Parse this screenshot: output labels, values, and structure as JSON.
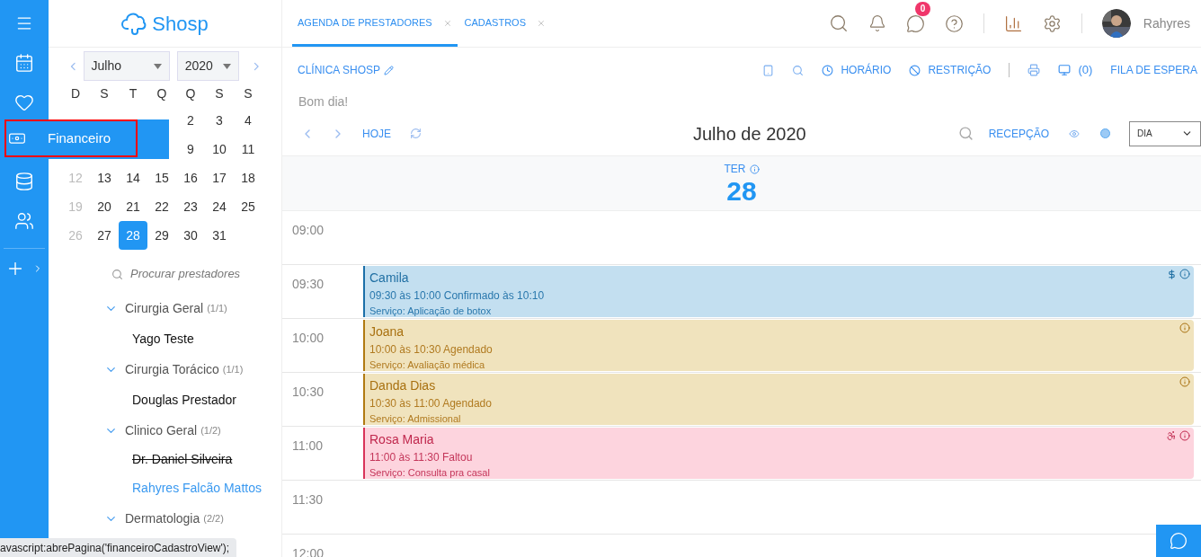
{
  "rail": {
    "tooltip": "Financeiro"
  },
  "logo": {
    "text": "Shosp"
  },
  "calendar": {
    "month": "Julho",
    "year": "2020",
    "weekdays": [
      "D",
      "S",
      "T",
      "Q",
      "Q",
      "S",
      "S"
    ],
    "weeks": [
      [
        {
          "day": "2",
          "muted": false,
          "selected": false
        },
        {
          "day": "3",
          "muted": false,
          "selected": false
        },
        {
          "day": "4",
          "muted": false,
          "selected": false
        }
      ],
      [
        {
          "day": "9",
          "muted": false,
          "selected": false
        },
        {
          "day": "10",
          "muted": false,
          "selected": false
        },
        {
          "day": "11",
          "muted": false,
          "selected": false
        }
      ],
      [
        {
          "day": "12",
          "muted": true,
          "selected": false
        },
        {
          "day": "13",
          "muted": false,
          "selected": false
        },
        {
          "day": "14",
          "muted": false,
          "selected": false
        },
        {
          "day": "15",
          "muted": false,
          "selected": false
        },
        {
          "day": "16",
          "muted": false,
          "selected": false
        },
        {
          "day": "17",
          "muted": false,
          "selected": false
        },
        {
          "day": "18",
          "muted": false,
          "selected": false
        }
      ],
      [
        {
          "day": "19",
          "muted": true,
          "selected": false
        },
        {
          "day": "20",
          "muted": false,
          "selected": false
        },
        {
          "day": "21",
          "muted": false,
          "selected": false
        },
        {
          "day": "22",
          "muted": false,
          "selected": false
        },
        {
          "day": "23",
          "muted": false,
          "selected": false
        },
        {
          "day": "24",
          "muted": false,
          "selected": false
        },
        {
          "day": "25",
          "muted": false,
          "selected": false
        }
      ],
      [
        {
          "day": "26",
          "muted": true,
          "selected": false
        },
        {
          "day": "27",
          "muted": false,
          "selected": false
        },
        {
          "day": "28",
          "muted": false,
          "selected": true
        },
        {
          "day": "29",
          "muted": false,
          "selected": false
        },
        {
          "day": "30",
          "muted": false,
          "selected": false
        },
        {
          "day": "31",
          "muted": false,
          "selected": false
        }
      ]
    ]
  },
  "search": {
    "placeholder": "Procurar prestadores"
  },
  "groups": [
    {
      "name": "Cirurgia Geral",
      "count": "(1/1)",
      "expanded": true,
      "children": [
        {
          "name": "Yago Teste",
          "inactive": false,
          "selected": false
        }
      ]
    },
    {
      "name": "Cirurgia Torácico",
      "count": "(1/1)",
      "expanded": true,
      "children": [
        {
          "name": "Douglas Prestador",
          "inactive": false,
          "selected": false
        }
      ]
    },
    {
      "name": "Clinico Geral",
      "count": "(1/2)",
      "expanded": true,
      "children": [
        {
          "name": "Dr. Daniel Silveira",
          "inactive": true,
          "selected": false
        },
        {
          "name": "Rahyres Falcão Mattos",
          "inactive": false,
          "selected": true
        }
      ]
    },
    {
      "name": "Dermatologia",
      "count": "(2/2)",
      "expanded": true
    }
  ],
  "status_bar": "avascript:abrePagina('financeiroCadastroView');",
  "tabs": [
    {
      "label": "AGENDA DE PRESTADORES",
      "selected": true
    },
    {
      "label": "CADASTROS",
      "selected": false
    }
  ],
  "header": {
    "chat_badge": "0",
    "user": "Rahyres"
  },
  "toolbar": {
    "clinic": "CLÍNICA SHOSP",
    "horario": "HORÁRIO",
    "restricao": "RESTRIÇÃO",
    "screen_count": "(0)",
    "queue": "FILA DE ESPERA"
  },
  "greeting": "Bom dia!",
  "nav": {
    "today": "HOJE",
    "title": "Julho de 2020",
    "reception": "RECEPÇÃO",
    "view": "DIA"
  },
  "day": {
    "weekday": "TER",
    "date": "28"
  },
  "slots": [
    {
      "time": "09:00"
    },
    {
      "time": "09:30",
      "event": {
        "kind": "confirmed",
        "name": "Camila",
        "time": "09:30 às 10:00 Confirmado às 10:10",
        "service": "Serviço: Aplicação de botox",
        "paid": true,
        "accessibility": false
      }
    },
    {
      "time": "10:00",
      "event": {
        "kind": "scheduled",
        "name": "Joana",
        "time": "10:00 às 10:30 Agendado",
        "service": "Serviço: Avaliação médica",
        "paid": false,
        "accessibility": false
      }
    },
    {
      "time": "10:30",
      "event": {
        "kind": "scheduled",
        "name": "Danda Dias",
        "time": "10:30 às 11:00 Agendado",
        "service": "Serviço: Admissional",
        "paid": false,
        "accessibility": false
      }
    },
    {
      "time": "11:00",
      "event": {
        "kind": "missed",
        "name": "Rosa Maria",
        "time": "11:00 às 11:30 Faltou",
        "service": "Serviço: Consulta pra casal",
        "paid": false,
        "accessibility": true
      }
    },
    {
      "time": "11:30"
    },
    {
      "time": "12:00"
    }
  ]
}
